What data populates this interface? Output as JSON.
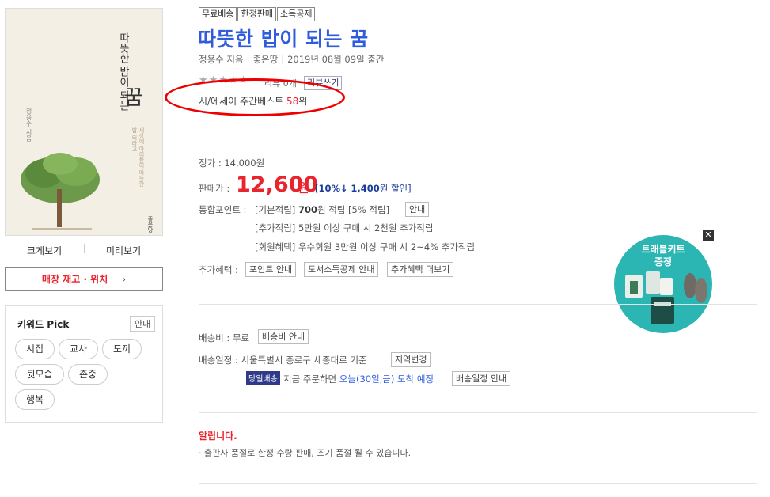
{
  "left": {
    "view_large": "크게보기",
    "preview": "미리보기",
    "stock_button": "매장 재고 · 위치",
    "stock_chevron": "›",
    "keyword_title": "키워드 Pick",
    "keyword_guide": "안내",
    "keywords": [
      "시집",
      "교사",
      "도끼",
      "뒷모습",
      "존중",
      "행복"
    ]
  },
  "cover": {
    "title_top": "따뜻한 밥이 되는",
    "title_big": "꿈",
    "author": "정용수 시음",
    "subtitle": "세상에 아이들이 따뜻한 밥 되라고",
    "publisher": "좋은땅"
  },
  "product": {
    "tags": [
      "무료배송",
      "한정판매",
      "소득공제"
    ],
    "title": "따뜻한 밥이 되는 꿈",
    "author": "정용수 지음",
    "publisher": "좋은땅",
    "pubdate": "2019년 08월 09일 출간",
    "stars": "★★★★★",
    "review_count": "리뷰 0개",
    "review_button": "리뷰쓰기",
    "rank_label": "시/에세이 주간베스트",
    "rank_value": "58",
    "rank_unit": "위"
  },
  "price": {
    "list_label": "정가 :",
    "list_value": "14,000원",
    "sale_label": "판매가 :",
    "sale_value": "12,600",
    "sale_unit": "원",
    "discount_open": "[",
    "discount_rate": "10%",
    "discount_arrow": "↓",
    "discount_amount": "1,400",
    "discount_text": "원 할인]"
  },
  "points": {
    "label": "통합포인트 :",
    "basic_prefix": "[기본적립]",
    "basic_value": "700",
    "basic_suffix": "원 적립",
    "basic_rate": "[5% 적립]",
    "guide_button": "안내",
    "extra": "[추가적립] 5만원 이상 구매 시 2천원 추가적립",
    "member": "[회원혜택] 우수회원 3만원 이상 구매 시 2~4% 추가적립"
  },
  "benefits": {
    "label": "추가혜택 :",
    "buttons": [
      "포인트 안내",
      "도서소득공제 안내",
      "추가혜택 더보기"
    ]
  },
  "promo": {
    "line1": "트래블키트",
    "line2": "증정",
    "close": "✕"
  },
  "shipping": {
    "fee_label": "배송비 :",
    "fee_value": "무료",
    "fee_button": "배송비 안내",
    "schedule_label": "배송일정 :",
    "schedule_location": "서울특별시 종로구 세종대로 기준",
    "region_button": "지역변경",
    "sameday_tag": "당일배송",
    "order_text": "지금 주문하면",
    "arrival": "오늘(30일,금) 도착 예정",
    "schedule_button": "배송일정 안내"
  },
  "notice": {
    "heading": "알립니다.",
    "text": "· 출판사 품절로 한정 수량 판매, 조기 품절 될 수 있습니다."
  },
  "colors": {
    "accent_red": "#e8242c",
    "title_blue": "#2f5cdc",
    "promo_teal": "#2bb6b4"
  }
}
